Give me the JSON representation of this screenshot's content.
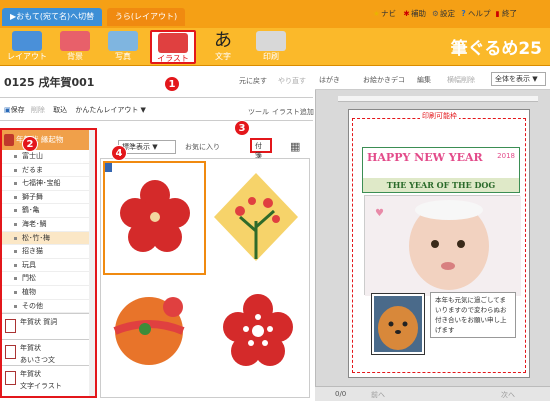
{
  "app": {
    "name": "筆ぐるめ25"
  },
  "tabs": {
    "front": "▶おもて(宛て名)へ切替",
    "layout": "うら(レイアウト)"
  },
  "top_menu": {
    "navi": "ナビ",
    "hokyo": "補助",
    "settei": "設定",
    "help": "ヘルプ",
    "exit": "終了"
  },
  "toolbar": {
    "layout": "レイアウト",
    "background": "背景",
    "photo": "写真",
    "illust": "イラスト",
    "text": "文字",
    "print": "印刷"
  },
  "doc": {
    "title": "0125 戌年賀001",
    "undo": "元に戻す",
    "redo": "やり直す"
  },
  "subbar": {
    "save": "保存",
    "delete": "削除",
    "fetch": "取込",
    "easy_layout": "かんたんレイアウト ▼",
    "tools": "ツール",
    "add_illust": "イラスト追加"
  },
  "right_bar": {
    "postcard": "はがき",
    "oekaki": "お絵かきデコ",
    "edit": "編集",
    "lock": "横幅削除",
    "view": "全体を表示"
  },
  "category": {
    "title": "年賀状 縁起物",
    "items": [
      "富士山",
      "だるま",
      "七福神･宝船",
      "獅子舞",
      "鶴･亀",
      "海老･鯛",
      "松･竹･梅",
      "招き猫",
      "玩具",
      "門松",
      "植物",
      "その他"
    ],
    "active_index": 6,
    "b1": "年賀状 賀詞",
    "b2a": "年賀状",
    "b2b": "あいさつ文",
    "b3a": "年賀状",
    "b3b": "文字イラスト"
  },
  "mid": {
    "display": "標準表示",
    "favorite": "お気に入り",
    "attach": "付箋"
  },
  "card": {
    "print_label": "印刷可能枠",
    "greeting": "HAPPY NEW YEAR",
    "year": "2018",
    "subtitle": "THE YEAR OF THE DOG",
    "message": "本年も元気に過ごしてまいりますので変わらぬお付き合いをお願い申し上げます"
  },
  "pager": {
    "page": "0/0",
    "prev": "前へ",
    "next": "次へ"
  },
  "markers": [
    "1",
    "2",
    "3",
    "4"
  ]
}
